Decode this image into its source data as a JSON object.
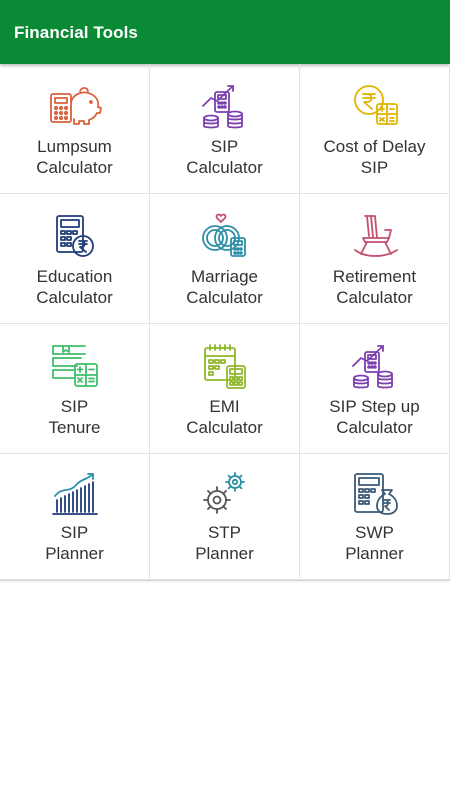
{
  "appbar": {
    "title": "Financial Tools"
  },
  "tools": [
    {
      "icon": "piggy-bank-calculator-icon",
      "line1": "Lumpsum",
      "line2": "Calculator"
    },
    {
      "icon": "calculator-coins-growth-icon",
      "line1": "SIP",
      "line2": "Calculator"
    },
    {
      "icon": "rupee-coin-calculator-icon",
      "line1": "Cost of Delay",
      "line2": "SIP"
    },
    {
      "icon": "rupee-calculator-icon",
      "line1": "Education",
      "line2": "Calculator"
    },
    {
      "icon": "wedding-rings-calculator-icon",
      "line1": "Marriage",
      "line2": "Calculator"
    },
    {
      "icon": "rocking-chair-icon",
      "line1": "Retirement",
      "line2": "Calculator"
    },
    {
      "icon": "books-calculator-icon",
      "line1": "SIP",
      "line2": "Tenure"
    },
    {
      "icon": "calendar-calculator-icon",
      "line1": "EMI",
      "line2": "Calculator"
    },
    {
      "icon": "calculator-coins-growth-icon",
      "line1": "SIP Step up",
      "line2": "Calculator"
    },
    {
      "icon": "growth-chart-icon",
      "line1": "SIP",
      "line2": "Planner"
    },
    {
      "icon": "gears-icon",
      "line1": "STP",
      "line2": "Planner"
    },
    {
      "icon": "calculator-money-bag-icon",
      "line1": "SWP",
      "line2": "Planner"
    }
  ],
  "colors": {
    "appbar": "#0a8a34",
    "orange": "#d9603b",
    "purple": "#7b3fb0",
    "yellow": "#e0b400",
    "navy": "#1f3d7a",
    "teal": "#2c8fa6",
    "rose": "#c44f6e",
    "green": "#3fbf6b",
    "lime": "#8fb82a",
    "slate": "#3a5a78"
  }
}
